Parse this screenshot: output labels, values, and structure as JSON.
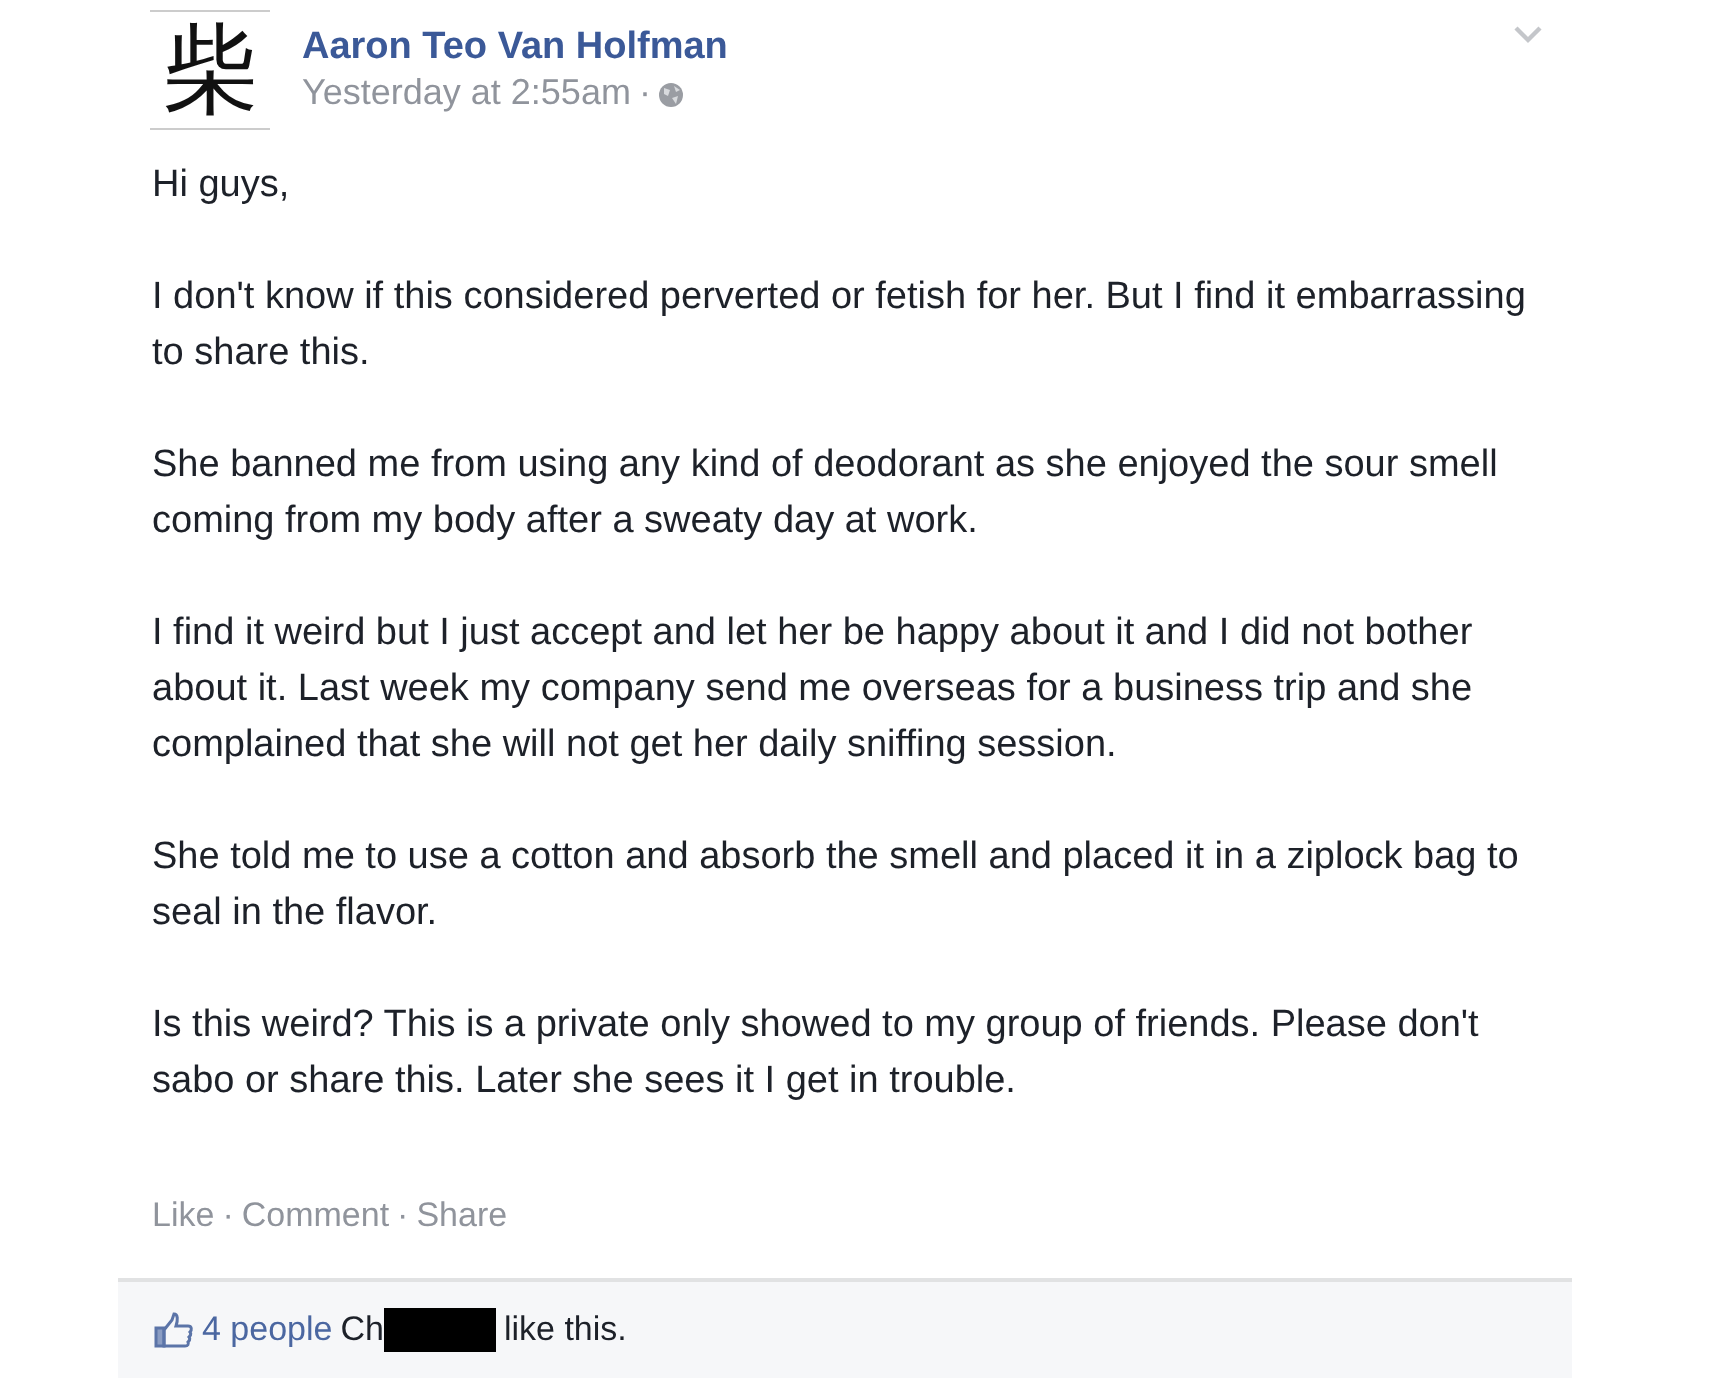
{
  "post": {
    "avatar_glyph": "柴",
    "author": "Aaron Teo Van Holfman",
    "time": "Yesterday at 2:55am",
    "separator": "·",
    "audience_public": true,
    "paragraphs": [
      "Hi guys,",
      "I don't know if this considered perverted or fetish for her. But I find it embarrassing to share this.",
      "She banned me from using any kind of deodorant as she enjoyed the sour smell coming from my body after a sweaty day at work.",
      "I find it weird but I just accept and let her be happy about it and I did not bother about it. Last week my company send me overseas for a business trip and she complained that she will not get her daily sniffing session.",
      "She told me to use a cotton and absorb the smell and placed it in a ziplock bag to seal in the flavor.",
      "Is this weird? This is a private only showed to my group of friends. Please don't sabo or share this. Later she sees it I get in trouble."
    ],
    "actions": [
      {
        "label": "Like"
      },
      {
        "label": "Comment"
      },
      {
        "label": "Share"
      }
    ],
    "likes": {
      "count_link": "4 people",
      "name_start": "Ch",
      "redacted": true,
      "suffix": "like this."
    }
  }
}
